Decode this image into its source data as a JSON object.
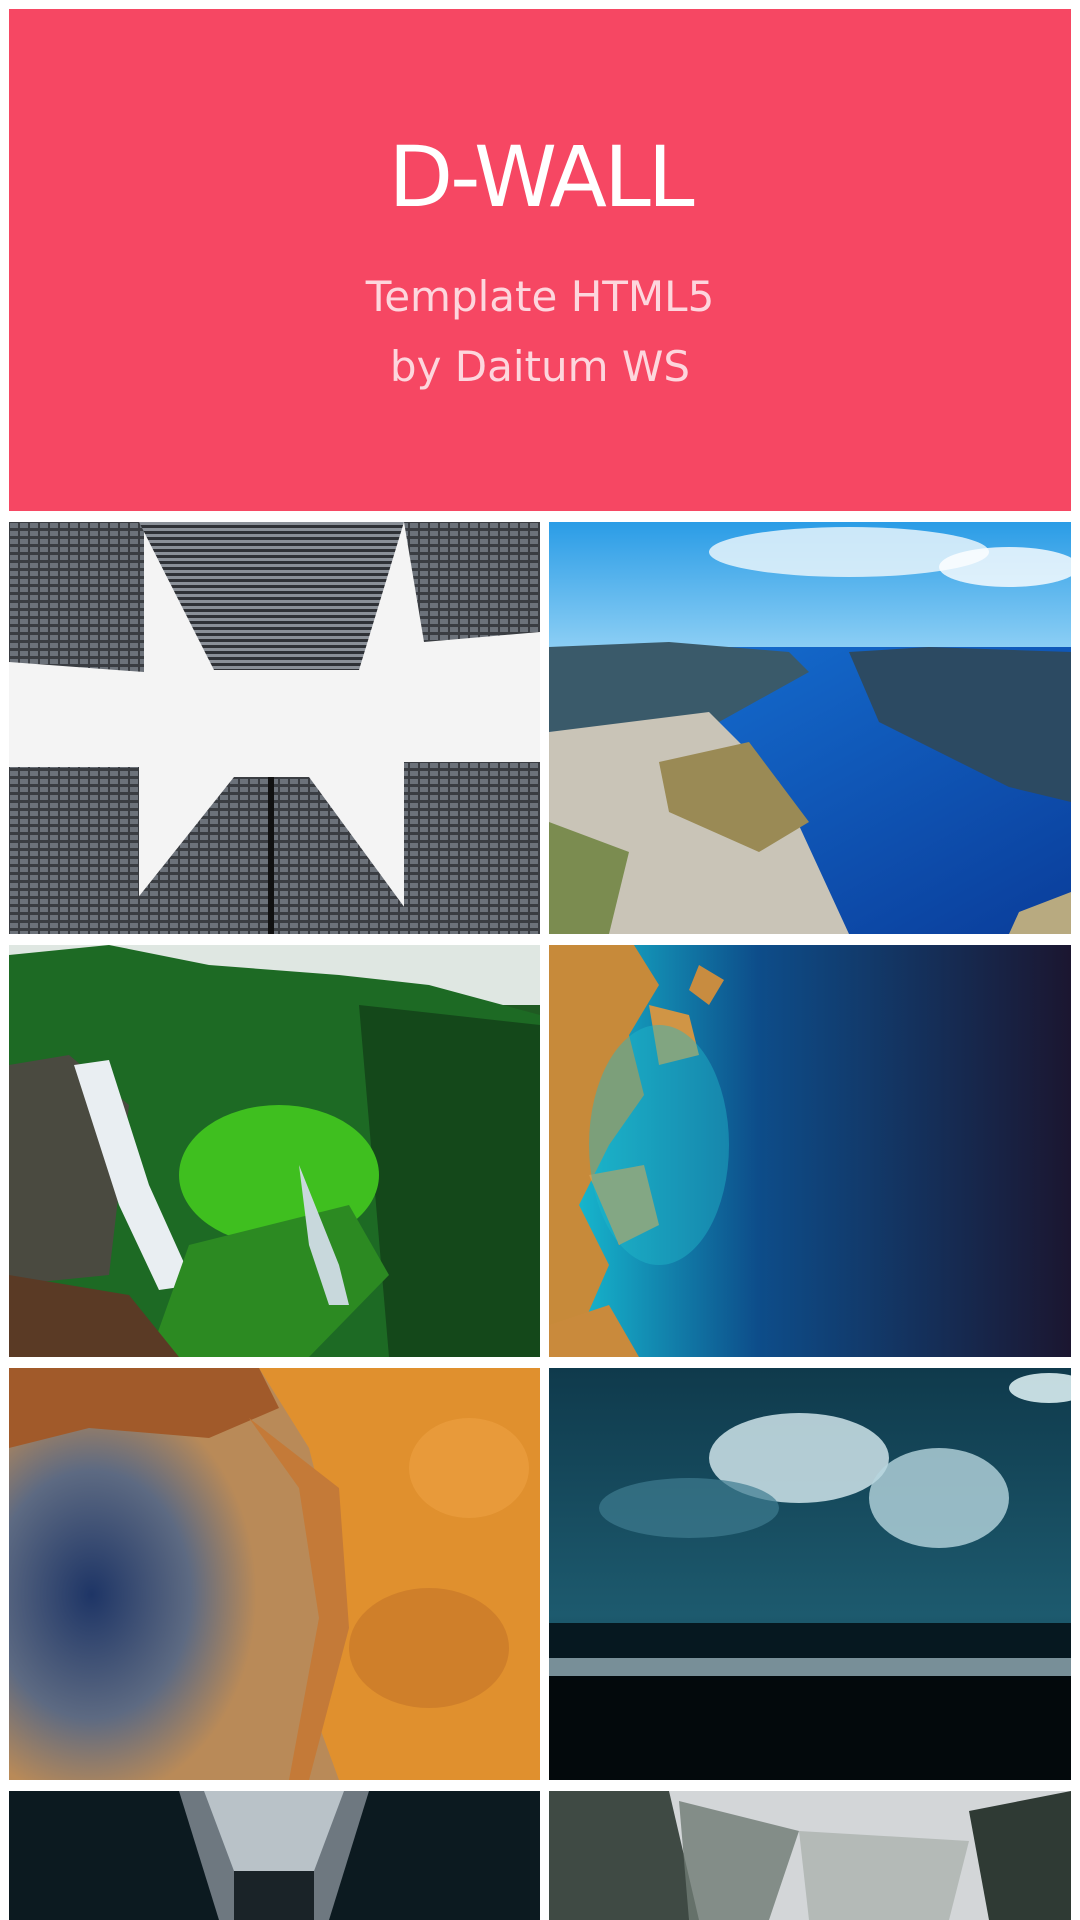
{
  "hero": {
    "title": "D-WALL",
    "subtitle_line1": "Template HTML5",
    "subtitle_line2": "by Daitum WS",
    "background_color": "#f64763"
  },
  "gallery": {
    "tiles": [
      {
        "icon": "skyscrapers-photo"
      },
      {
        "icon": "fjord-photo"
      },
      {
        "icon": "waterfall-forest-photo"
      },
      {
        "icon": "aerial-coast-photo"
      },
      {
        "icon": "desert-crater-photo"
      },
      {
        "icon": "stormy-sea-photo"
      },
      {
        "icon": "corridor-photo"
      },
      {
        "icon": "misty-forest-photo"
      }
    ]
  }
}
